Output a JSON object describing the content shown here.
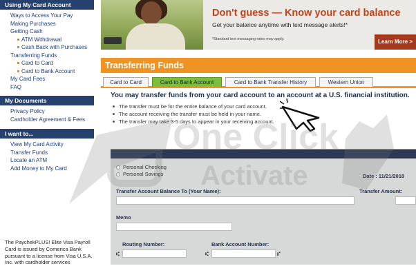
{
  "sidebar": {
    "card_heading": "Using My Card Account",
    "card_links": [
      {
        "label": "Ways to Access Your Pay",
        "sub": false
      },
      {
        "label": "Making Purchases",
        "sub": false
      },
      {
        "label": "Getting Cash",
        "sub": false
      },
      {
        "label": "ATM Withdrawal",
        "sub": true
      },
      {
        "label": "Cash Back with Purchases",
        "sub": true
      },
      {
        "label": "Transferring Funds",
        "sub": false
      },
      {
        "label": "Card to Card",
        "sub": true
      },
      {
        "label": "Card to Bank Account",
        "sub": true
      },
      {
        "label": "My Card Fees",
        "sub": false
      },
      {
        "label": "FAQ",
        "sub": false
      }
    ],
    "docs_heading": "My Documents",
    "docs_links": [
      "Privacy Policy",
      "Cardholder Agreement & Fees"
    ],
    "want_heading": "I want to...",
    "want_links": [
      "View My Card Activity",
      "Transfer Funds",
      "Locate an ATM",
      "Add Money to My Card"
    ],
    "footer": "The PaychekPLUS! Elite Visa Payroll Card is issued by Comerica Bank pursuant to a license from Visa U.S.A. Inc. with cardholder services"
  },
  "banner": {
    "title": "Don't guess — Know your card balance",
    "subtitle": "Get your balance anytime with text message alerts!*",
    "note": "*Standard text messaging rates may apply.",
    "cta": "Learn More >"
  },
  "page": {
    "title": "Transferring Funds",
    "tabs": [
      {
        "label": "Card to Card",
        "active": false
      },
      {
        "label": "Card to Bank Account",
        "active": true
      },
      {
        "label": "Card to Bank Transfer History",
        "active": false
      },
      {
        "label": "Western Union",
        "active": false
      }
    ],
    "heading": "You may transfer funds from your card account to an account at a U.S. financial institution.",
    "bullets": [
      "The transfer must be for the entire balance of your card account.",
      "The account receiving the transfer must be held in your name.",
      "The transfer may take 3-5 days to appear in your receiving account."
    ]
  },
  "form": {
    "options": [
      "Personal Checking",
      "Personal Savings"
    ],
    "date_label": "Date : 11/21/2018",
    "balance_label": "Transfer Account Balance To (Your Name):",
    "amount_label": "Transfer Amount:",
    "memo_label": "Memo",
    "routing_label": "Routing Number:",
    "account_label": "Bank Account Number:"
  },
  "watermark": "One Click Activate",
  "colors": {
    "navy": "#26416e",
    "orange": "#ef9424",
    "green_tab": "#7cbd3a",
    "brand_red": "#c0421a"
  }
}
